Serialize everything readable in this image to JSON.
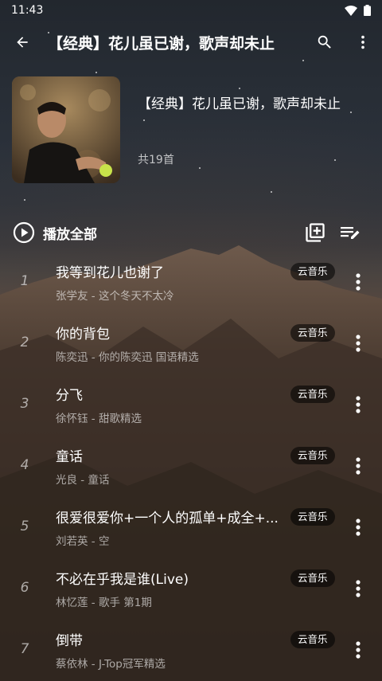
{
  "status_bar": {
    "time": "11:43"
  },
  "app_bar": {
    "title": "【经典】花儿虽已谢，歌声却未止"
  },
  "playlist": {
    "name": "【经典】花儿虽已谢，歌声却未止",
    "count_text": "共19首"
  },
  "play_all": {
    "label": "播放全部"
  },
  "songs": [
    {
      "index": "1",
      "title": "我等到花儿也谢了",
      "subtitle": "张学友 - 这个冬天不太冷",
      "source": "云音乐"
    },
    {
      "index": "2",
      "title": "你的背包",
      "subtitle": "陈奕迅 - 你的陈奕迅 国语精选",
      "source": "云音乐"
    },
    {
      "index": "3",
      "title": "分飞",
      "subtitle": "徐怀钰 - 甜歌精选",
      "source": "云音乐"
    },
    {
      "index": "4",
      "title": "童话",
      "subtitle": "光良 - 童话",
      "source": "云音乐"
    },
    {
      "index": "5",
      "title": "很爱很爱你+一个人的孤单+成全+...",
      "subtitle": "刘若英 - 空",
      "source": "云音乐"
    },
    {
      "index": "6",
      "title": "不必在乎我是谁(Live)",
      "subtitle": "林忆莲 - 歌手 第1期",
      "source": "云音乐"
    },
    {
      "index": "7",
      "title": "倒带",
      "subtitle": "蔡依林 - J-Top冠军精选",
      "source": "云音乐"
    }
  ]
}
